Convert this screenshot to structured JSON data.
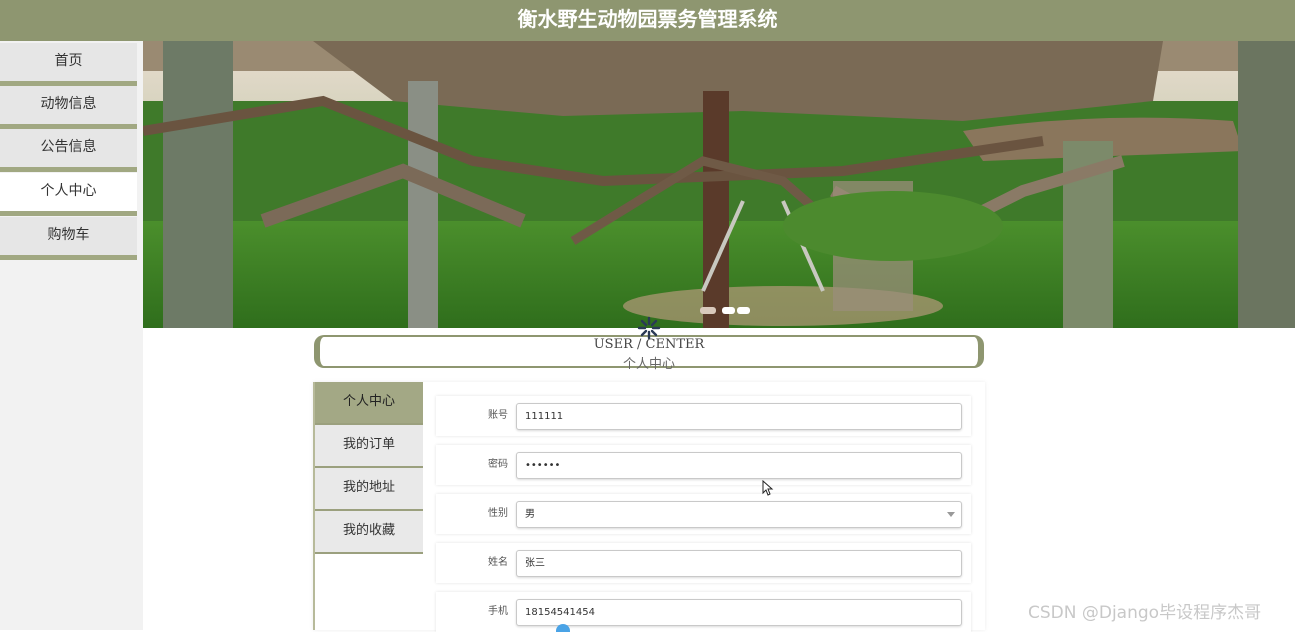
{
  "header": {
    "title": "衡水野生动物园票务管理系统"
  },
  "sidebar": {
    "items": [
      {
        "label": "首页",
        "active": false
      },
      {
        "label": "动物信息",
        "active": false
      },
      {
        "label": "公告信息",
        "active": false
      },
      {
        "label": "个人中心",
        "active": true
      },
      {
        "label": "购物车",
        "active": false
      }
    ]
  },
  "banner": {
    "slides": 3,
    "active_slide": 1
  },
  "section": {
    "title_en": "USER / CENTER",
    "title_cn": "个人中心"
  },
  "user_menu": {
    "items": [
      {
        "label": "个人中心",
        "active": true
      },
      {
        "label": "我的订单",
        "active": false
      },
      {
        "label": "我的地址",
        "active": false
      },
      {
        "label": "我的收藏",
        "active": false
      }
    ]
  },
  "form": {
    "account": {
      "label": "账号",
      "value": "111111"
    },
    "password": {
      "label": "密码",
      "value": "••••••"
    },
    "gender": {
      "label": "性别",
      "value": "男"
    },
    "name": {
      "label": "姓名",
      "value": "张三"
    },
    "phone": {
      "label": "手机",
      "value": "18154541454"
    }
  },
  "watermark": "CSDN @Django毕设程序杰哥",
  "colors": {
    "accent": "#8e9670",
    "accent_light": "#a3a885"
  }
}
